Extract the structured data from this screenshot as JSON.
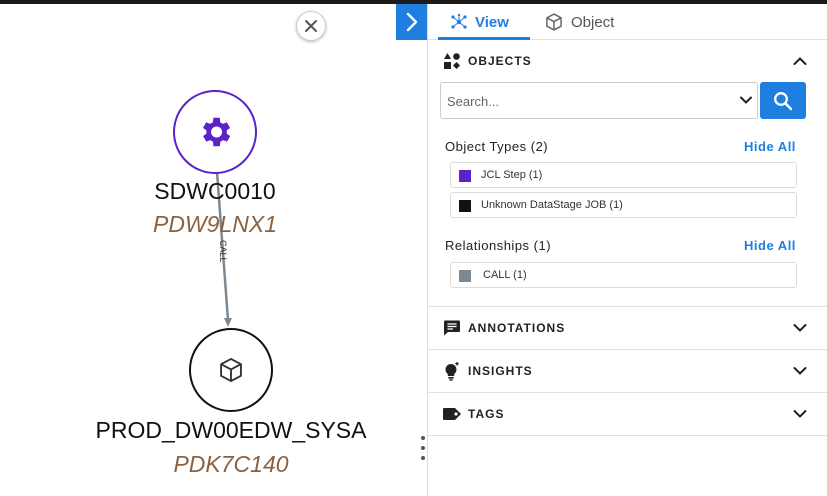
{
  "graph": {
    "nodes": [
      {
        "title": "SDWC0010",
        "subtitle": "PDW9LNX1",
        "icon": "gear-icon",
        "border_color": "#5a22c8"
      },
      {
        "title": "PROD_DW00EDW_SYSA",
        "subtitle": "PDK7C140",
        "icon": "cube-icon",
        "border_color": "#111111"
      }
    ],
    "edge_label": "CALL"
  },
  "tabs": [
    {
      "label": "View",
      "icon": "network-icon",
      "active": true
    },
    {
      "label": "Object",
      "icon": "cube-icon",
      "active": false
    }
  ],
  "objects": {
    "title": "OBJECTS",
    "search_placeholder": "Search...",
    "object_types_title": "Object Types (2)",
    "object_types_hide": "Hide All",
    "object_types": [
      {
        "label": "JCL Step (1)",
        "color": "#5a22c8"
      },
      {
        "label": "Unknown DataStage JOB (1)",
        "color": "#111111"
      }
    ],
    "relationships_title": "Relationships (1)",
    "relationships_hide": "Hide All",
    "relationships": [
      {
        "label": "CALL (1)",
        "color": "#7d8890"
      }
    ]
  },
  "sections": [
    {
      "title": "ANNOTATIONS",
      "icon": "comment-icon"
    },
    {
      "title": "INSIGHTS",
      "icon": "lightbulb-icon"
    },
    {
      "title": "TAGS",
      "icon": "tag-icon"
    }
  ],
  "colors": {
    "accent": "#1f7fe0",
    "jcl_step": "#5a22c8",
    "edge": "#7d8890"
  }
}
